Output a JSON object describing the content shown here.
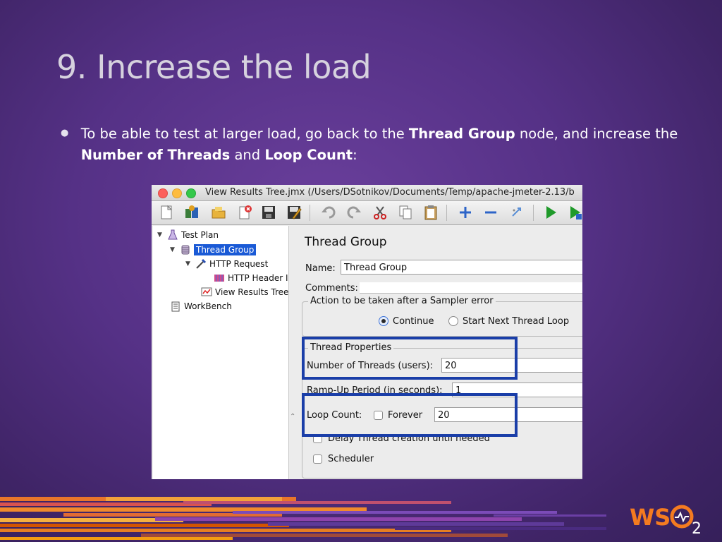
{
  "slide": {
    "title": "9. Increase the load",
    "bullet": {
      "pre": "To be able to test at larger load, go back to the ",
      "b1": "Thread Group",
      "mid1": " node, and increase the ",
      "b2": "Number of Threads",
      "mid2": " and ",
      "b3": "Loop Count",
      "post": ":"
    }
  },
  "window": {
    "title": "View Results Tree.jmx (/Users/DSotnikov/Documents/Temp/apache-jmeter-2.13/b"
  },
  "toolbar": {
    "buttons": [
      "new-icon",
      "templates-icon",
      "open-icon",
      "close-icon",
      "save-icon",
      "save-as-icon",
      "undo-icon",
      "redo-icon",
      "cut-icon",
      "copy-icon",
      "paste-icon",
      "expand-icon",
      "collapse-icon",
      "toggle-icon",
      "start-icon",
      "start-no-pause-icon"
    ]
  },
  "tree": {
    "items": [
      {
        "label": "Test Plan",
        "icon": "test-plan-icon"
      },
      {
        "label": "Thread Group",
        "icon": "thread-group-icon",
        "selected": true
      },
      {
        "label": "HTTP Request",
        "icon": "http-request-icon"
      },
      {
        "label": "HTTP Header I",
        "icon": "http-header-icon"
      },
      {
        "label": "View Results Tree",
        "icon": "results-tree-icon"
      },
      {
        "label": "WorkBench",
        "icon": "workbench-icon"
      }
    ]
  },
  "panel": {
    "title": "Thread Group",
    "name_label": "Name:",
    "name_value": "Thread Group",
    "comments_label": "Comments:",
    "comments_value": "",
    "error_group_title": "Action to be taken after a Sampler error",
    "radio_continue": "Continue",
    "radio_start_next": "Start Next Thread Loop",
    "thread_props_title": "Thread Properties",
    "threads_label": "Number of Threads (users):",
    "threads_value": "20",
    "rampup_label": "Ramp-Up Period (in seconds):",
    "rampup_value": "1",
    "loop_label": "Loop Count:",
    "forever_label": "Forever",
    "loop_value": "20",
    "delay_label": "Delay Thread creation until needed",
    "scheduler_label": "Scheduler"
  },
  "colors": {
    "highlight": "#1a3ea8",
    "selection": "#1a5ad6",
    "logo_orange": "#f47b20"
  },
  "logo": {
    "text": "WSO",
    "suffix": "2"
  }
}
